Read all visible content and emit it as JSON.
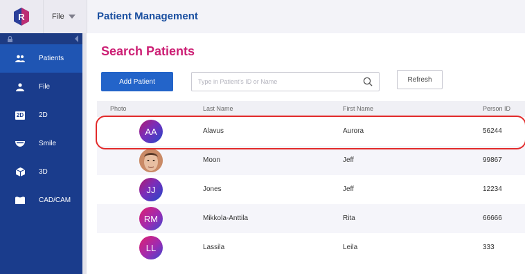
{
  "header": {
    "file_menu": "File",
    "app_title": "Patient Management"
  },
  "sidebar": {
    "items": [
      {
        "label": "Patients",
        "icon": "people-icon"
      },
      {
        "label": "File",
        "icon": "person-icon"
      },
      {
        "label": "2D",
        "icon": "2d-icon",
        "badge": "2D"
      },
      {
        "label": "Smile",
        "icon": "smile-icon"
      },
      {
        "label": "3D",
        "icon": "cube-icon"
      },
      {
        "label": "CAD/CAM",
        "icon": "tooth-icon"
      }
    ]
  },
  "main": {
    "title": "Search Patients",
    "add_button": "Add Patient",
    "search_placeholder": "Type in Patient's ID or Name",
    "refresh_button": "Refresh",
    "columns": {
      "photo": "Photo",
      "last_name": "Last Name",
      "first_name": "First Name",
      "person_id": "Person ID"
    },
    "rows": [
      {
        "initials": "AA",
        "last_name": "Alavus",
        "first_name": "Aurora",
        "person_id": "56244"
      },
      {
        "initials": "",
        "last_name": "Moon",
        "first_name": "Jeff",
        "person_id": "99867"
      },
      {
        "initials": "JJ",
        "last_name": "Jones",
        "first_name": "Jeff",
        "person_id": "12234"
      },
      {
        "initials": "RM",
        "last_name": "Mikkola-Anttila",
        "first_name": "Rita",
        "person_id": "66666"
      },
      {
        "initials": "LL",
        "last_name": "Lassila",
        "first_name": "Leila",
        "person_id": "333"
      }
    ]
  },
  "colors": {
    "accent_blue": "#2364c9",
    "sidebar": "#1a3c8c",
    "title_pink": "#cc1f74",
    "highlight": "#e22a2a"
  }
}
